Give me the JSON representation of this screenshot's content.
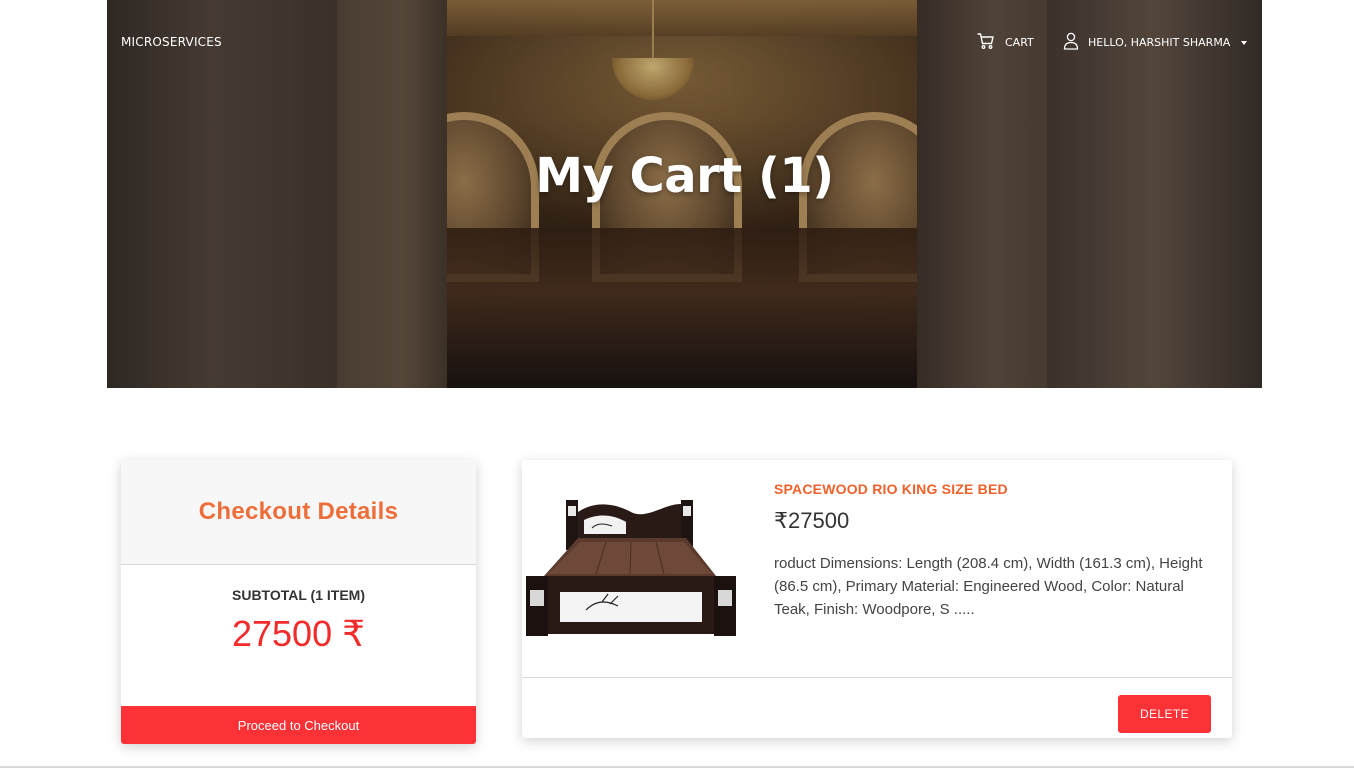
{
  "navbar": {
    "brand": "MICROSERVICES",
    "cart_label": "CART",
    "user_label": "HELLO, HARSHIT SHARMA"
  },
  "hero": {
    "title": "My Cart (1)"
  },
  "checkout": {
    "title": "Checkout Details",
    "subtotal_label": "SUBTOTAL (1 ITEM)",
    "subtotal_value": "27500 ₹",
    "proceed_label": "Proceed to Checkout"
  },
  "cart_items": [
    {
      "name": "SPACEWOOD RIO KING SIZE BED",
      "price": "₹27500",
      "description": "roduct Dimensions: Length (208.4 cm), Width (161.3 cm), Height (86.5 cm), Primary Material: Engineered Wood, Color: Natural Teak, Finish: Woodpore, S .....",
      "delete_label": "DELETE"
    }
  ],
  "colors": {
    "accent_orange": "#f0612c",
    "accent_red": "#fc3237",
    "price_red": "#f22b2b"
  },
  "icons": {
    "cart": "cart-icon",
    "user": "user-icon",
    "dropdown": "caret-down-icon"
  }
}
